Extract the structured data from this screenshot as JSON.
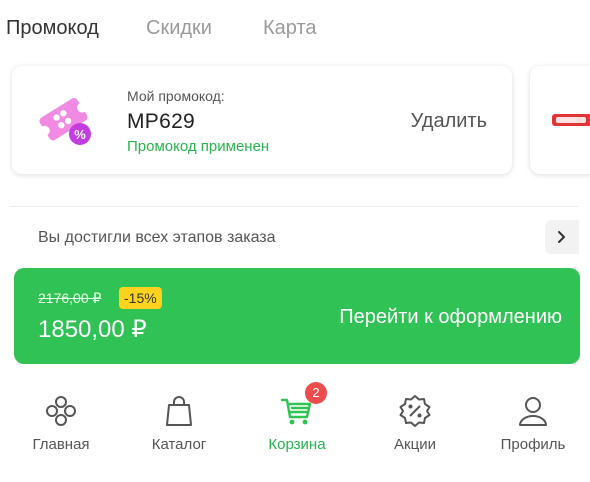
{
  "tabs": [
    {
      "label": "Промокод",
      "active": true
    },
    {
      "label": "Скидки",
      "active": false
    },
    {
      "label": "Карта",
      "active": false
    }
  ],
  "promo": {
    "label": "Мой промокод:",
    "code": "MP629",
    "status": "Промокод применен",
    "delete_label": "Удалить",
    "icon": "coupon-percent-icon"
  },
  "next_card": {
    "icon": "product-thumbnail"
  },
  "stage": {
    "text": "Вы достигли всех этапов заказа",
    "arrow_icon": "chevron-right-icon"
  },
  "checkout": {
    "old_price": "2176,00 ₽",
    "discount": "-15%",
    "new_price": "1850,00 ₽",
    "label": "Перейти к оформлению"
  },
  "nav": [
    {
      "label": "Главная",
      "icon": "home-icon"
    },
    {
      "label": "Каталог",
      "icon": "bag-icon"
    },
    {
      "label": "Корзина",
      "icon": "cart-icon",
      "badge": "2",
      "active": true
    },
    {
      "label": "Акции",
      "icon": "percent-badge-icon"
    },
    {
      "label": "Профиль",
      "icon": "profile-icon"
    }
  ],
  "colors": {
    "accent_green": "#30c254",
    "active_green": "#28b44b",
    "badge_red": "#ee4d4d",
    "discount_yellow": "#ffd21e",
    "promo_pink": "#e85fd6"
  }
}
